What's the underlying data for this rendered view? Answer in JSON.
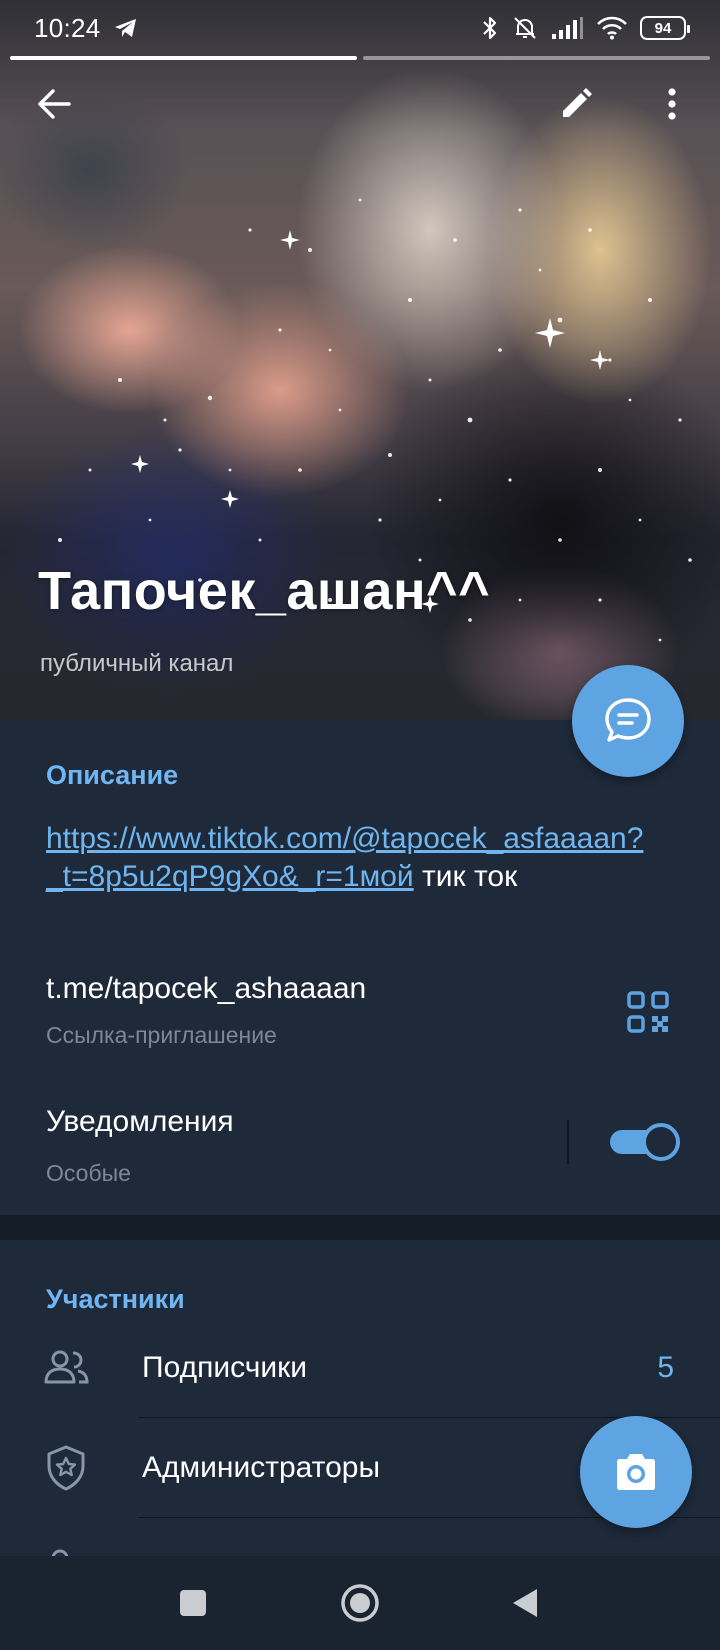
{
  "status_bar": {
    "time": "10:24",
    "battery": "94"
  },
  "header": {
    "title": "Тапочек_ашан^^",
    "subtitle": "публичный канал"
  },
  "info": {
    "description_title": "Описание",
    "description_link": "https://www.tiktok.com/@tapocek_asfaaaan?_t=8p5u2qP9gXo&_r=1мой",
    "description_text": " тик ток",
    "invite_link": "t.me/tapocek_ashaaaan",
    "invite_caption": "Ссылка-приглашение",
    "notifications_label": "Уведомления",
    "notifications_caption": "Особые",
    "notifications_enabled": true
  },
  "members": {
    "title": "Участники",
    "rows": [
      {
        "label": "Подписчики",
        "count": "5",
        "icon": "people-icon"
      },
      {
        "label": "Администраторы",
        "count": "",
        "icon": "admin-shield-icon"
      }
    ]
  },
  "colors": {
    "accent": "#5fa4e2",
    "link": "#6fb5ef",
    "section_title": "#71b6f2",
    "card_bg": "#1e2a3a",
    "page_bg": "#1d2733"
  }
}
